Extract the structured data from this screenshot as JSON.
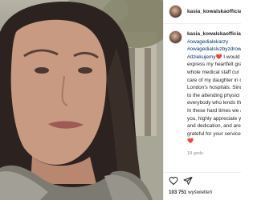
{
  "post": {
    "username": "kasia_kowalskaofficial",
    "header_separator": "•"
  },
  "caption": {
    "username": "kasia_kowalskaofficial",
    "hashtags": [
      "#owagedialekarzy",
      "#owagedialsluzbyzdrowi",
      "#dziekujemy"
    ],
    "lines": [
      "I would",
      "express my heartfelt grati",
      "whole medical staff cur",
      "care of my daughter in o",
      "London's hospitals. Sinc",
      "to the attending physici",
      "everybody who lends th",
      "In these hard times we a",
      "you, highly appreciate yo",
      "and dedication, and are",
      "grateful for your services"
    ],
    "end_heart": "❤️",
    "time": "18 godz."
  },
  "stats": {
    "views_count": "103 751",
    "views_label": "wyświetleń"
  },
  "icons": {
    "header_avatar": "profile-avatar",
    "caption_avatar": "profile-avatar",
    "like": "heart-outline-icon",
    "share": "paper-plane-icon"
  },
  "colors": {
    "link": "#00376b",
    "heart": "#ed4956",
    "text": "#262626",
    "muted": "#8e8e8e"
  }
}
